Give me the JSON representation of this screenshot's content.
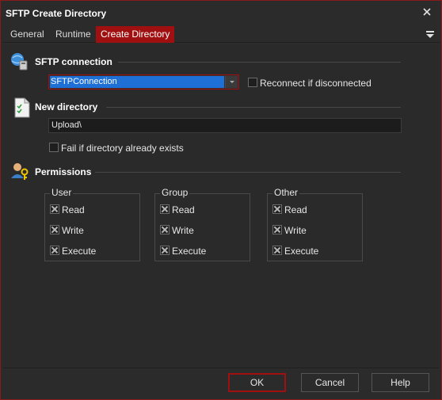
{
  "window": {
    "title": "SFTP Create Directory"
  },
  "tabs": [
    {
      "label": "General",
      "active": false
    },
    {
      "label": "Runtime",
      "active": false
    },
    {
      "label": "Create Directory",
      "active": true
    }
  ],
  "sftp": {
    "section_title": "SFTP connection",
    "connection_value": "SFTPConnection",
    "reconnect_label": "Reconnect if disconnected",
    "reconnect_checked": false
  },
  "new_directory": {
    "section_title": "New directory",
    "path_value": "Upload\\",
    "fail_if_exists_label": "Fail if directory already exists",
    "fail_if_exists_checked": false
  },
  "permissions": {
    "section_title": "Permissions",
    "groups": [
      {
        "title": "User",
        "read": "Read",
        "write": "Write",
        "execute": "Execute"
      },
      {
        "title": "Group",
        "read": "Read",
        "write": "Write",
        "execute": "Execute"
      },
      {
        "title": "Other",
        "read": "Read",
        "write": "Write",
        "execute": "Execute"
      }
    ]
  },
  "buttons": {
    "ok": "OK",
    "cancel": "Cancel",
    "help": "Help"
  },
  "colors": {
    "accent": "#a11010",
    "selection": "#1e6fd6",
    "background": "#2b2b2b"
  }
}
